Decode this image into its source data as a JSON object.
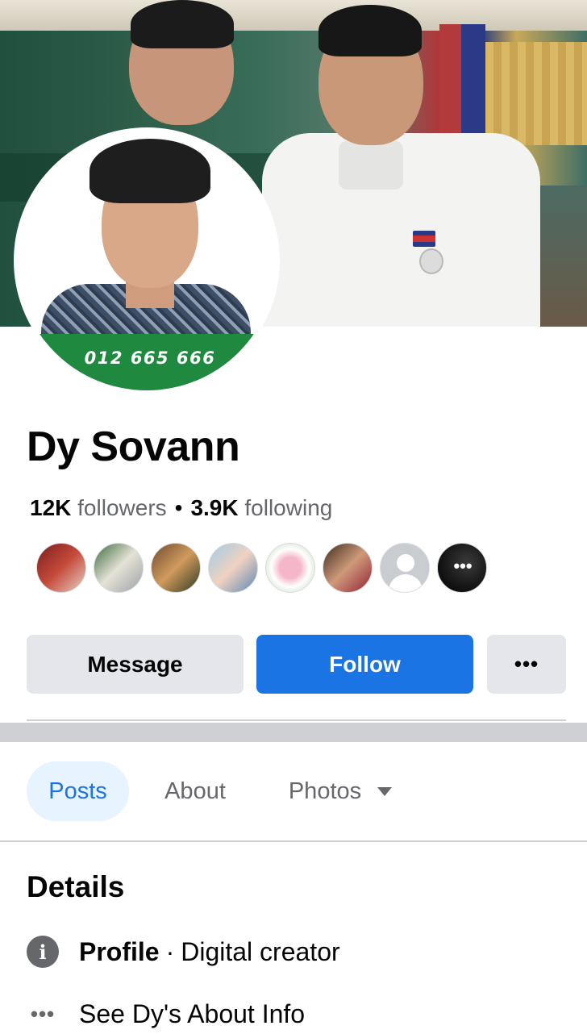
{
  "cover": {
    "phone_number": "012 665 666"
  },
  "profile": {
    "name": "Dy Sovann",
    "followers_count": "12K",
    "followers_label": "followers",
    "separator": "•",
    "following_count": "3.9K",
    "following_label": "following"
  },
  "friends": {
    "more_label": "•••",
    "count_shown": 8
  },
  "actions": {
    "message_label": "Message",
    "follow_label": "Follow",
    "more_label": "•••"
  },
  "tabs": {
    "posts": "Posts",
    "about": "About",
    "photos": "Photos"
  },
  "details": {
    "title": "Details",
    "profile_label": "Profile",
    "profile_separator": "·",
    "profile_value": "Digital creator",
    "about_link": "See Dy's About Info",
    "info_icon_glyph": "i",
    "dots_icon_glyph": "•••"
  },
  "colors": {
    "accent": "#1b74e4",
    "tab_active_bg": "#e7f3ff",
    "secondary_text": "#65676b",
    "button_gray": "#e4e6eb",
    "phone_band": "#1f8a3f"
  }
}
